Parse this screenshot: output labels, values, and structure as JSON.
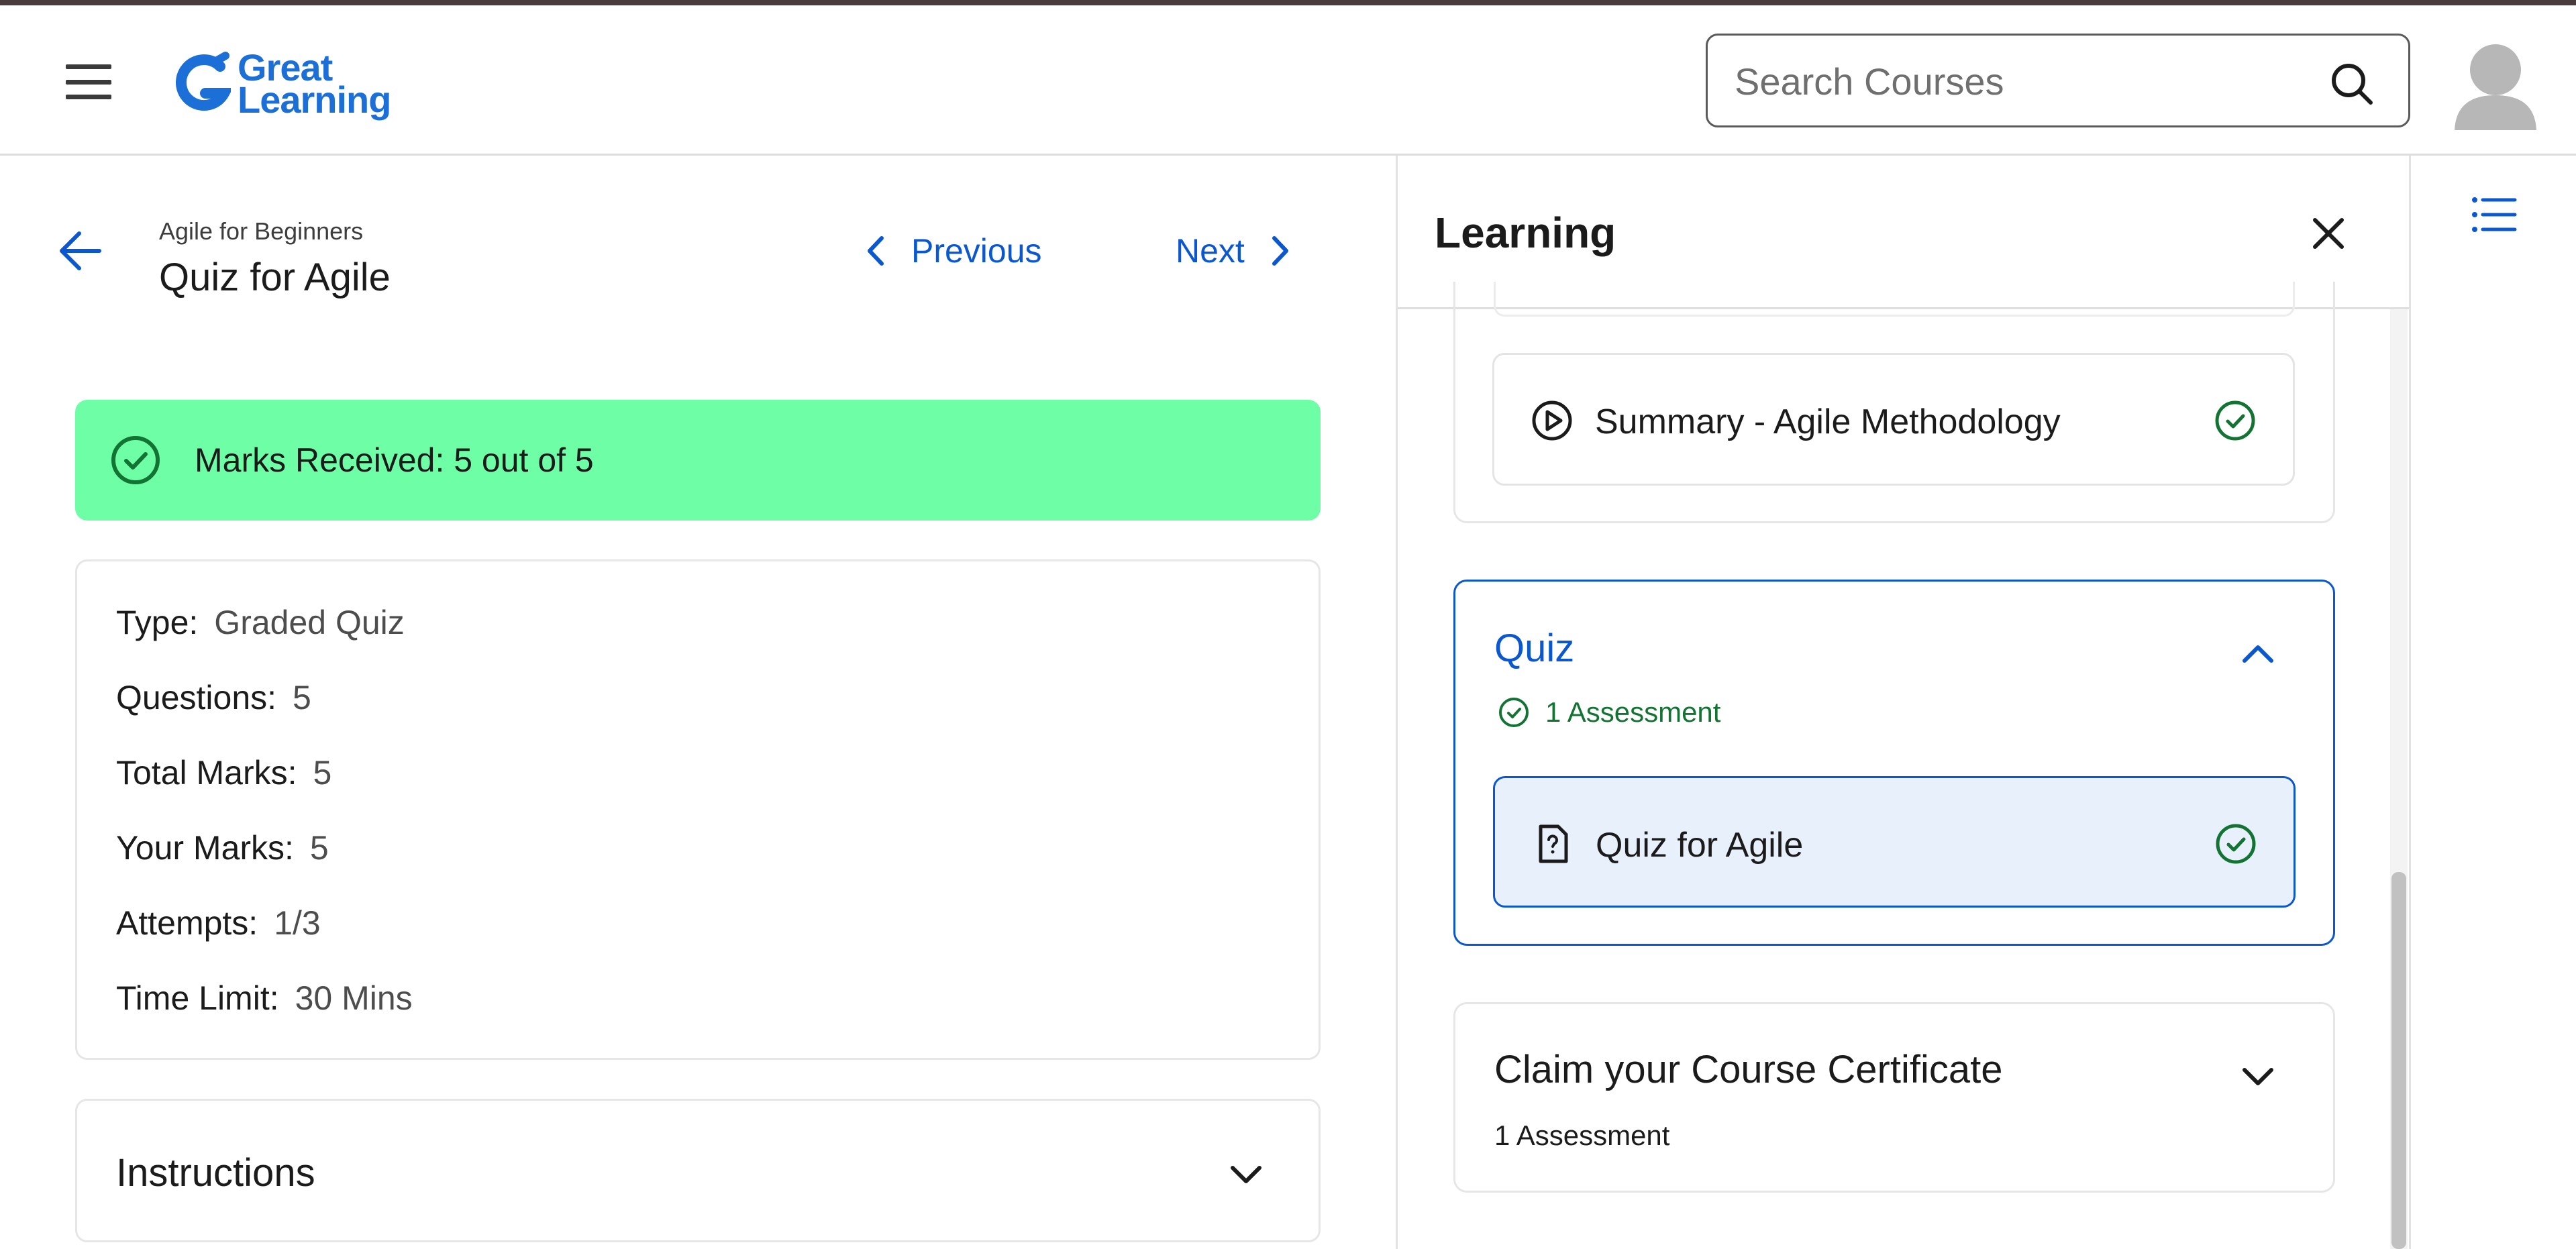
{
  "header": {
    "logo_line1": "Great",
    "logo_line2": "Learning",
    "search_placeholder": "Search Courses"
  },
  "lesson": {
    "course_name": "Agile for Beginners",
    "title": "Quiz for Agile",
    "previous_label": "Previous",
    "next_label": "Next"
  },
  "result": {
    "marks_text": "Marks Received: 5 out of 5"
  },
  "details": [
    {
      "label": "Type:",
      "value": "Graded Quiz"
    },
    {
      "label": "Questions:",
      "value": "5"
    },
    {
      "label": "Total Marks:",
      "value": "5"
    },
    {
      "label": "Your Marks:",
      "value": "5"
    },
    {
      "label": "Attempts:",
      "value": "1/3"
    },
    {
      "label": "Time Limit:",
      "value": "30 Mins"
    }
  ],
  "instructions": {
    "title": "Instructions"
  },
  "panel": {
    "title": "Learning",
    "summary_item": "Summary - Agile Methodology",
    "quiz_section": {
      "title": "Quiz",
      "meta": "1 Assessment",
      "item": "Quiz for Agile"
    },
    "cert_section": {
      "title": "Claim your Course Certificate",
      "meta": "1 Assessment"
    }
  },
  "colors": {
    "accent": "#0b57d0",
    "success_banner": "#6effa6",
    "success_icon": "#137333",
    "selected_item_bg": "#e8f0fc"
  }
}
